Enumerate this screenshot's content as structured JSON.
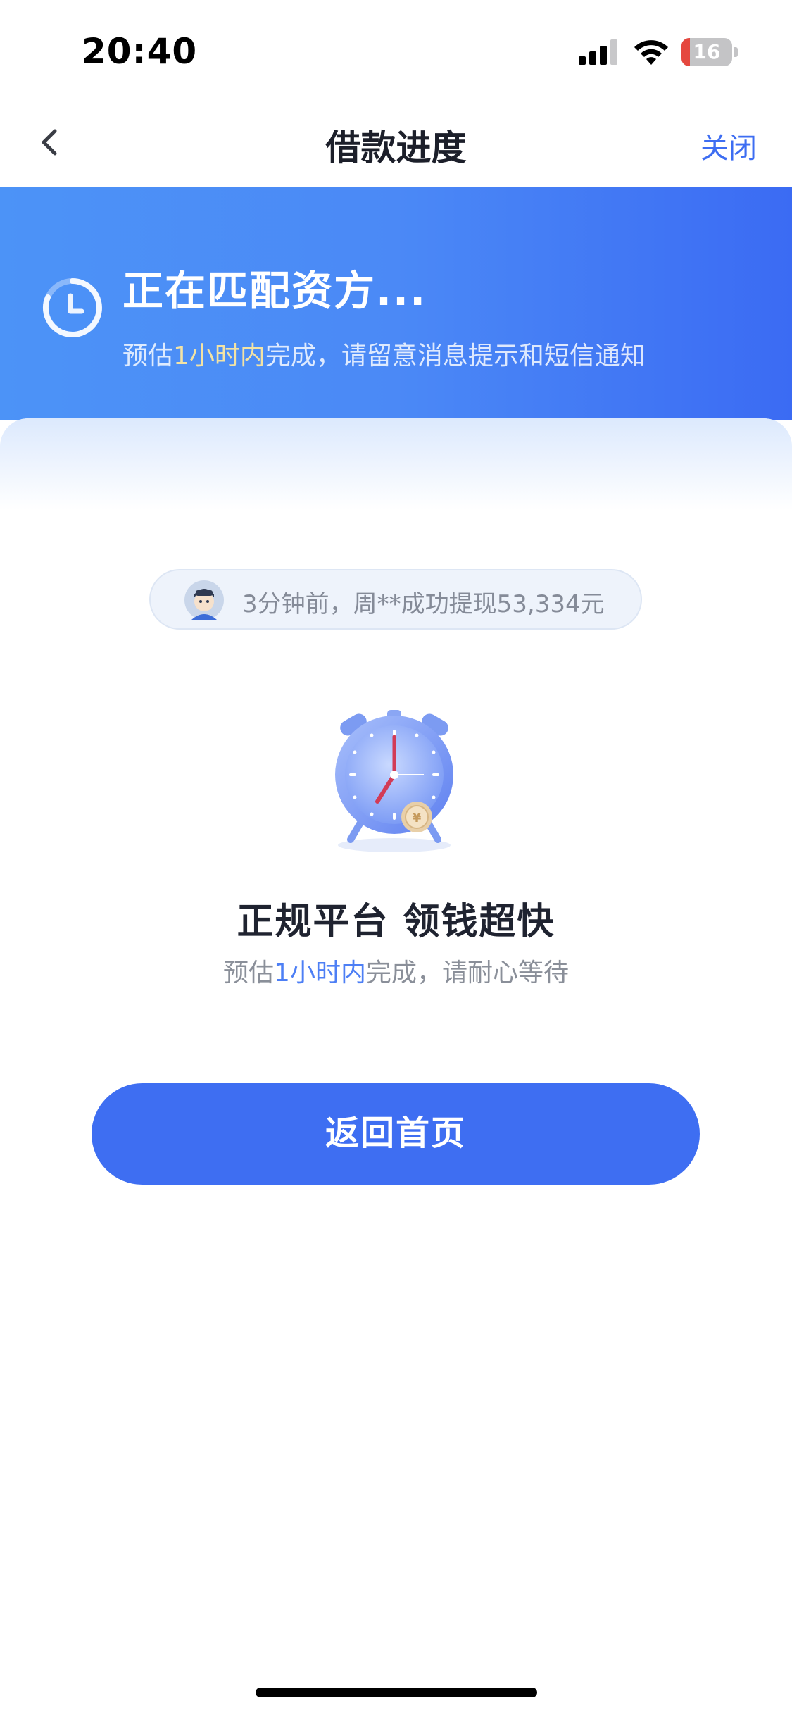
{
  "status_bar": {
    "time": "20:40",
    "battery_level": "16",
    "battery_percent": 16
  },
  "nav": {
    "title": "借款进度",
    "close_label": "关闭"
  },
  "banner": {
    "title": "正在匹配资方...",
    "subtitle_prefix": "预估",
    "subtitle_highlight": "1小时内",
    "subtitle_suffix": "完成，请留意消息提示和短信通知"
  },
  "ticker": {
    "text": "3分钟前，周**成功提现53,334元"
  },
  "promo": {
    "title": "正规平台 领钱超快",
    "subtitle_prefix": "预估",
    "subtitle_highlight": "1小时内",
    "subtitle_suffix": "完成，请耐心等待"
  },
  "actions": {
    "home_label": "返回首页"
  },
  "colors": {
    "accent": "#3e6ef2",
    "banner_start": "#4c93f7",
    "banner_end": "#3b6bf3",
    "highlight_yellow": "#f3e3a4"
  }
}
